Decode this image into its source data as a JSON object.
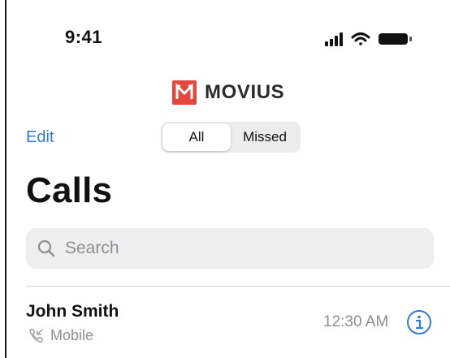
{
  "status_bar": {
    "time": "9:41"
  },
  "brand": {
    "name": "MOVIUS",
    "logo_color": "#e4473b"
  },
  "nav": {
    "edit_label": "Edit",
    "segments": [
      {
        "label": "All",
        "selected": true
      },
      {
        "label": "Missed",
        "selected": false
      }
    ]
  },
  "page": {
    "title": "Calls"
  },
  "search": {
    "placeholder": "Search",
    "value": ""
  },
  "calls": [
    {
      "name": "John Smith",
      "type": "Mobile",
      "time": "12:30 AM"
    }
  ],
  "colors": {
    "accent": "#2f7ad8",
    "secondary_text": "#8e8e93"
  },
  "icons": [
    "signal-icon",
    "wifi-icon",
    "battery-icon",
    "search-icon",
    "incoming-call-icon",
    "info-icon"
  ]
}
